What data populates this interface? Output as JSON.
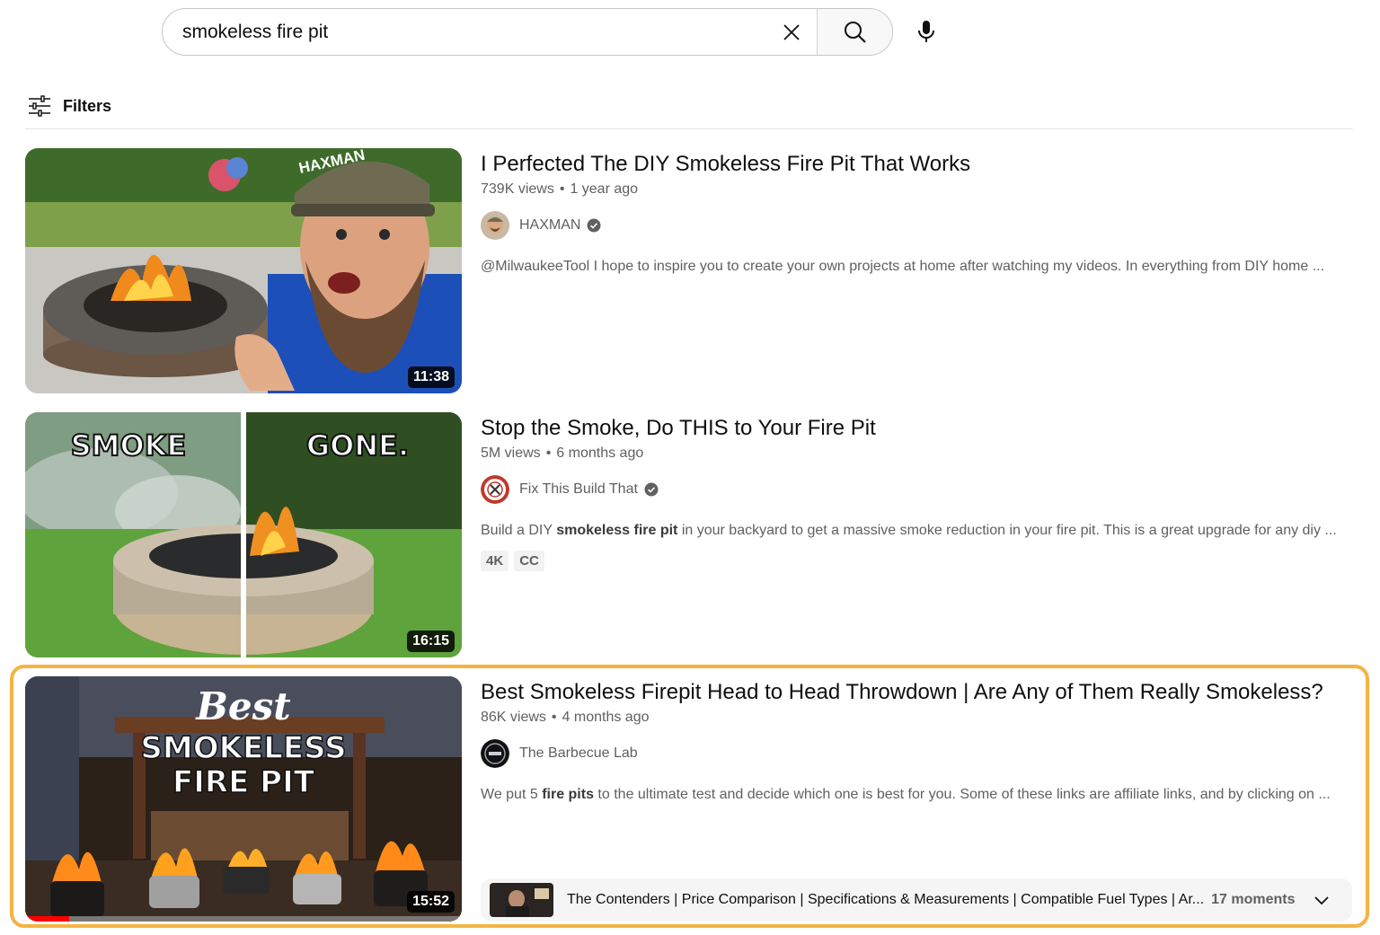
{
  "search": {
    "value": "smokeless fire pit",
    "clear_icon": "close-icon",
    "search_icon": "search-icon",
    "mic_icon": "microphone-icon"
  },
  "filters": {
    "label": "Filters",
    "icon": "sliders-icon"
  },
  "results": [
    {
      "title": "I Perfected The DIY Smokeless Fire Pit That Works",
      "views": "739K views",
      "age": "1 year ago",
      "channel": "HAXMAN",
      "verified": true,
      "description": "@MilwaukeeTool I hope to inspire you to create your own projects at home after watching my videos. In everything from DIY home ...",
      "duration": "11:38",
      "thumb_text": "HAXMAN"
    },
    {
      "title": "Stop the Smoke, Do THIS to Your Fire Pit",
      "views": "5M views",
      "age": "6 months ago",
      "channel": "Fix This Build That",
      "verified": true,
      "description_pre": "Build a DIY ",
      "description_bold": "smokeless fire pit",
      "description_post": " in your backyard to get a massive smoke reduction in your fire pit. This is a great upgrade for any diy ...",
      "badges": [
        "4K",
        "CC"
      ],
      "duration": "16:15",
      "thumb_text_left": "SMOKE",
      "thumb_text_right": "GONE."
    },
    {
      "title": "Best Smokeless Firepit Head to Head Throwdown | Are Any of Them Really Smokeless?",
      "views": "86K views",
      "age": "4 months ago",
      "channel": "The Barbecue Lab",
      "verified": false,
      "description_pre": "We put 5 ",
      "description_bold": "fire pits",
      "description_post": " to the ultimate test and decide which one is best for you. Some of these links are affiliate links, and by clicking on ...",
      "duration": "15:52",
      "watch_progress": 0.1,
      "thumb_text_1": "Best",
      "thumb_text_2": "SMOKELESS",
      "thumb_text_3": "FIRE PIT",
      "moments_text": "The Contenders | Price Comparison | Specifications & Measurements | Compatible Fuel Types | Ar...",
      "moments_count": "17 moments"
    }
  ],
  "colors": {
    "highlight": "#f5b342",
    "progress": "#ff0000",
    "meta": "#606060"
  }
}
